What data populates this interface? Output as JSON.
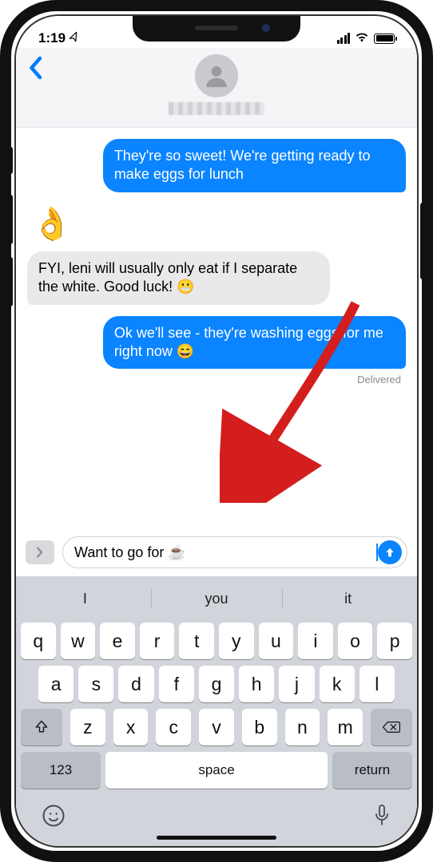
{
  "status": {
    "time": "1:19",
    "loc_glyph": "➤"
  },
  "header": {
    "contact_name_redacted": true
  },
  "messages": [
    {
      "dir": "out",
      "text": "They're so sweet! We're getting ready to make eggs for lunch"
    },
    {
      "dir": "tapback",
      "emoji": "👌"
    },
    {
      "dir": "in",
      "text": "FYI, leni will usually only eat if I separate the white. Good luck! 😬"
    },
    {
      "dir": "out",
      "text": "Ok we'll see - they're washing eggs for me right now 😄"
    }
  ],
  "delivered_label": "Delivered",
  "compose": {
    "text": "Want to go for ☕️ "
  },
  "suggestions": [
    "I",
    "you",
    "it"
  ],
  "keyboard": {
    "row1": [
      "q",
      "w",
      "e",
      "r",
      "t",
      "y",
      "u",
      "i",
      "o",
      "p"
    ],
    "row2": [
      "a",
      "s",
      "d",
      "f",
      "g",
      "h",
      "j",
      "k",
      "l"
    ],
    "row3": [
      "z",
      "x",
      "c",
      "v",
      "b",
      "n",
      "m"
    ],
    "num_label": "123",
    "space_label": "space",
    "return_label": "return"
  }
}
